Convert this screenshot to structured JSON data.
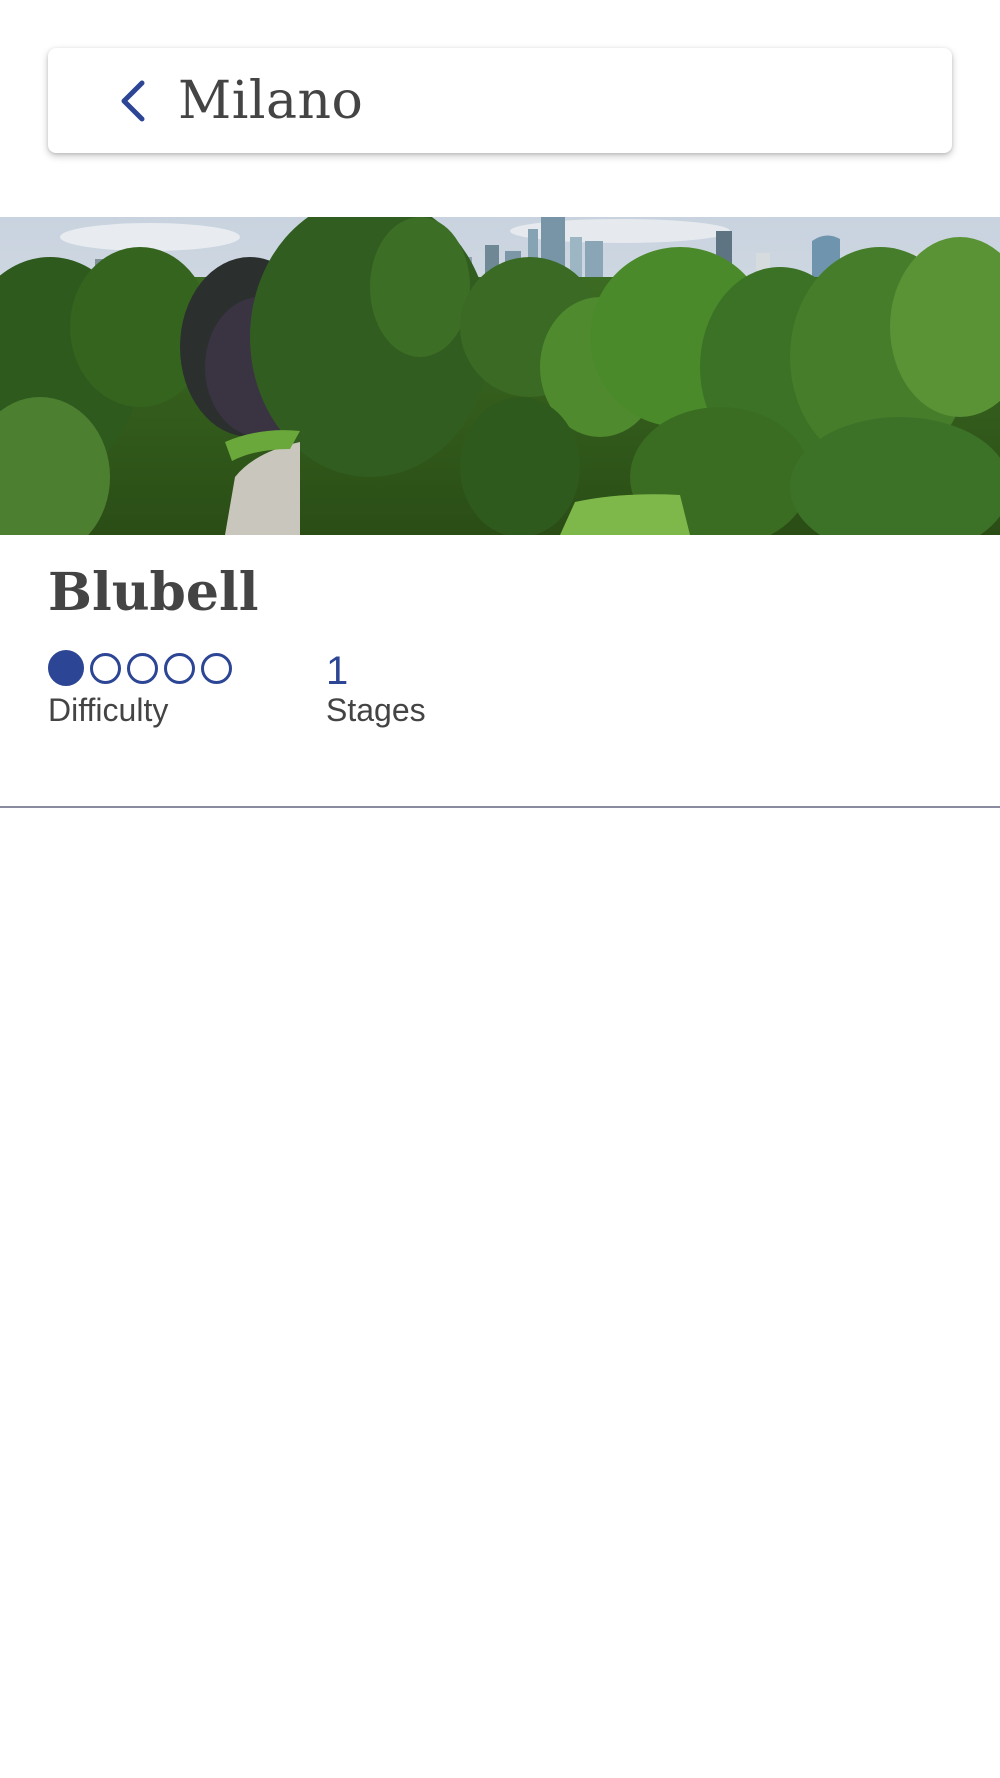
{
  "header": {
    "title": "Milano",
    "back_icon": "chevron-left-icon"
  },
  "hero_image": {
    "subject": "Milan park trees with city skyline"
  },
  "route": {
    "name": "Blubell",
    "difficulty": {
      "value": 1,
      "max": 5,
      "label": "Difficulty"
    },
    "stages": {
      "value": "1",
      "label": "Stages"
    }
  },
  "colors": {
    "accent": "#2c4594",
    "text": "#444444",
    "divider": "#8a8aa0"
  }
}
